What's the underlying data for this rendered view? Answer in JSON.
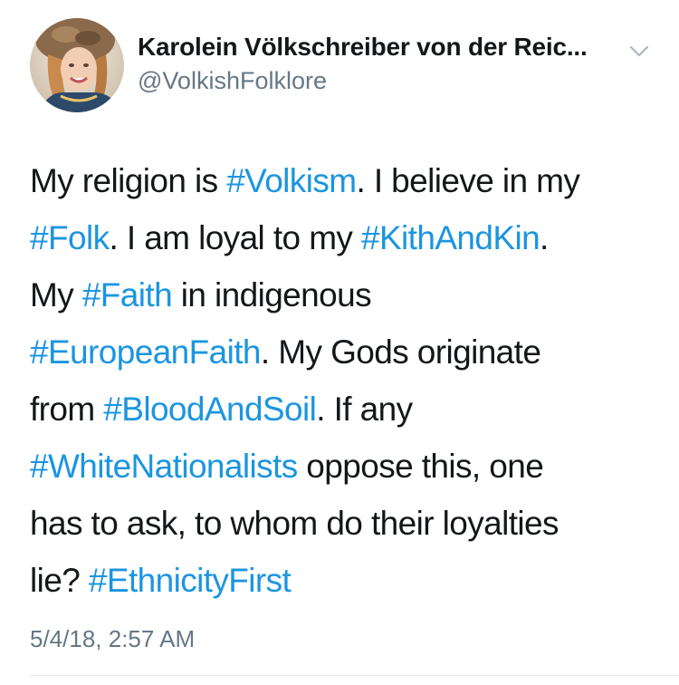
{
  "author": {
    "display_name": "Karolein Völkschreiber von der Reic...",
    "handle": "@VolkishFolklore",
    "avatar": "profile-photo"
  },
  "icons": {
    "caret": "chevron-down-icon"
  },
  "colors": {
    "link": "#1b95e0",
    "text": "#14171a",
    "secondary": "#657786"
  },
  "tweet": {
    "lines": [
      [
        {
          "text": "My religion is "
        },
        {
          "text": "#Volkism",
          "hashtag": true
        },
        {
          "text": ". I believe in my"
        }
      ],
      [
        {
          "text": "#Folk",
          "hashtag": true
        },
        {
          "text": ". I am loyal to my "
        },
        {
          "text": "#KithAndKin",
          "hashtag": true
        },
        {
          "text": "."
        }
      ],
      [
        {
          "text": "My "
        },
        {
          "text": "#Faith",
          "hashtag": true
        },
        {
          "text": " in indigenous"
        }
      ],
      [
        {
          "text": "#EuropeanFaith",
          "hashtag": true
        },
        {
          "text": ". My Gods originate"
        }
      ],
      [
        {
          "text": "from "
        },
        {
          "text": "#BloodAndSoil",
          "hashtag": true
        },
        {
          "text": ". If any"
        }
      ],
      [
        {
          "text": "#WhiteNationalists",
          "hashtag": true
        },
        {
          "text": " oppose this, one"
        }
      ],
      [
        {
          "text": "has to ask, to whom do their loyalties"
        }
      ],
      [
        {
          "text": "lie? "
        },
        {
          "text": "#EthnicityFirst",
          "hashtag": true
        }
      ]
    ],
    "timestamp": "5/4/18, 2:57 AM"
  }
}
